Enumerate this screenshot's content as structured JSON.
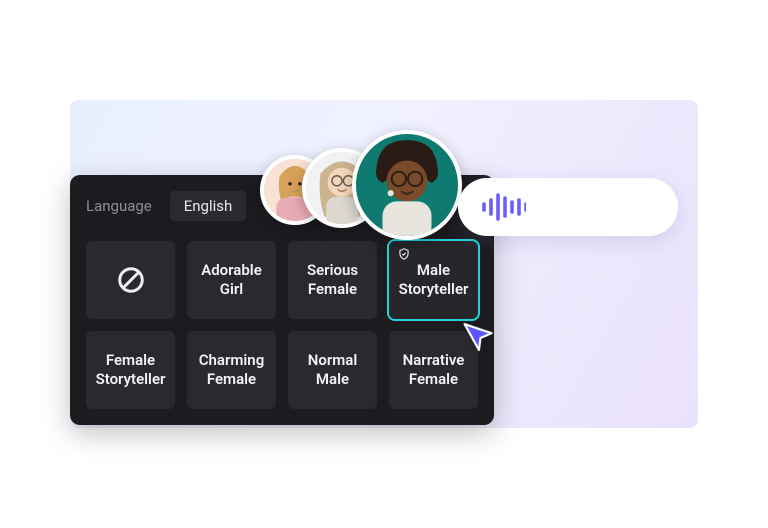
{
  "colors": {
    "accent_cyan": "#25d2d8",
    "accent_purple": "#6a5cff",
    "panel_bg": "#1c1b20",
    "tile_bg": "#2a292f"
  },
  "language": {
    "label": "Language",
    "selected": "English"
  },
  "voices": {
    "none_icon": "prohibit-icon",
    "items": [
      {
        "id": "none",
        "line1": "",
        "line2": "",
        "is_none": true,
        "selected": false
      },
      {
        "id": "adorable-girl",
        "line1": "Adorable",
        "line2": "Girl",
        "is_none": false,
        "selected": false
      },
      {
        "id": "serious-female",
        "line1": "Serious",
        "line2": "Female",
        "is_none": false,
        "selected": false
      },
      {
        "id": "male-storyteller",
        "line1": "Male",
        "line2": "Storyteller",
        "is_none": false,
        "selected": true
      },
      {
        "id": "female-storyteller",
        "line1": "Female",
        "line2": "Storyteller",
        "is_none": false,
        "selected": false
      },
      {
        "id": "charming-female",
        "line1": "Charming",
        "line2": "Female",
        "is_none": false,
        "selected": false
      },
      {
        "id": "normal-male",
        "line1": "Normal",
        "line2": "Male",
        "is_none": false,
        "selected": false
      },
      {
        "id": "narrative-female",
        "line1": "Narrative",
        "line2": "Female",
        "is_none": false,
        "selected": false
      }
    ]
  },
  "avatars": [
    {
      "id": "avatar-girl"
    },
    {
      "id": "avatar-woman"
    },
    {
      "id": "avatar-man"
    }
  ],
  "audio": {
    "icon": "waveform-icon"
  },
  "cursor_icon": "pointer-cursor"
}
